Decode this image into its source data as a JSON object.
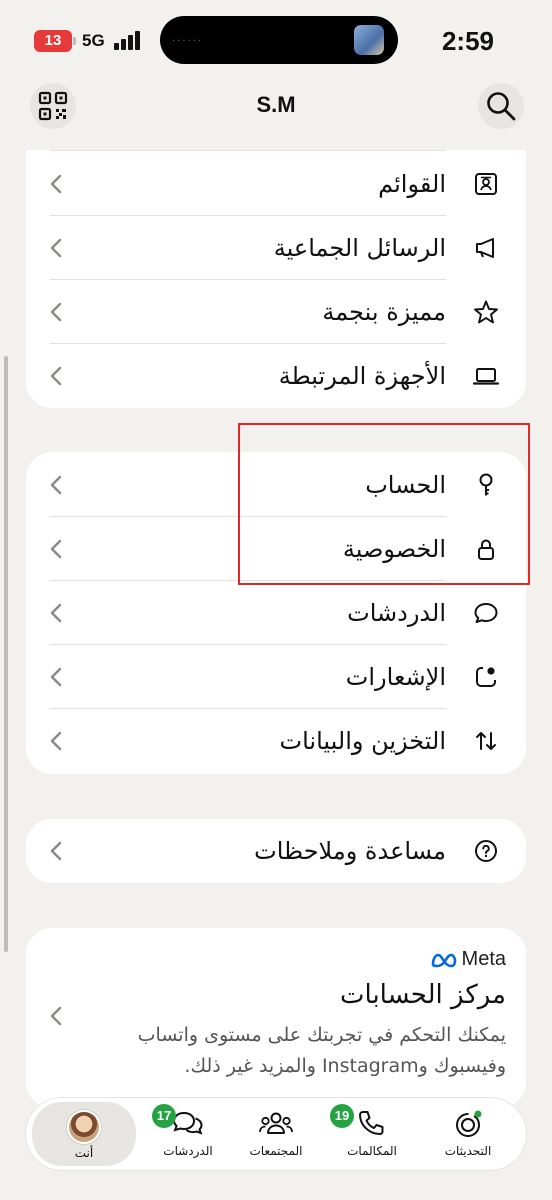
{
  "status_bar": {
    "time": "2:59",
    "battery_level": "13",
    "network": "5G",
    "island_dots": "······"
  },
  "header": {
    "title": "S.M"
  },
  "colors": {
    "accent_green": "#25a244",
    "highlight_red": "#e02626",
    "meta_blue": "#0668E1"
  },
  "menu_groups": [
    {
      "items": [
        {
          "label": "القوائم",
          "icon": "contacts-list-icon"
        },
        {
          "label": "الرسائل الجماعية",
          "icon": "megaphone-icon"
        },
        {
          "label": "مميزة بنجمة",
          "icon": "star-icon"
        },
        {
          "label": "الأجهزة المرتبطة",
          "icon": "laptop-icon"
        }
      ]
    },
    {
      "items": [
        {
          "label": "الحساب",
          "icon": "key-icon"
        },
        {
          "label": "الخصوصية",
          "icon": "lock-icon"
        },
        {
          "label": "الدردشات",
          "icon": "chat-bubble-icon"
        },
        {
          "label": "الإشعارات",
          "icon": "notification-icon"
        },
        {
          "label": "التخزين والبيانات",
          "icon": "storage-arrows-icon"
        }
      ]
    },
    {
      "items": [
        {
          "label": "مساعدة وملاحظات",
          "icon": "help-icon"
        }
      ]
    }
  ],
  "meta_card": {
    "brand": "Meta",
    "title": "مركز الحسابات",
    "description": "يمكنك التحكم في تجربتك على مستوى واتساب وفيسبوك وInstagram والمزيد غير ذلك."
  },
  "bottom_nav": {
    "items": [
      {
        "label": "التحديثات",
        "icon": "updates-icon",
        "badge": null
      },
      {
        "label": "المكالمات",
        "icon": "phone-icon",
        "badge": "19"
      },
      {
        "label": "المجتمعات",
        "icon": "communities-icon",
        "badge": null
      },
      {
        "label": "الدردشات",
        "icon": "chats-icon",
        "badge": "17"
      },
      {
        "label": "أنت",
        "icon": "avatar",
        "badge": null,
        "active": true
      }
    ]
  }
}
